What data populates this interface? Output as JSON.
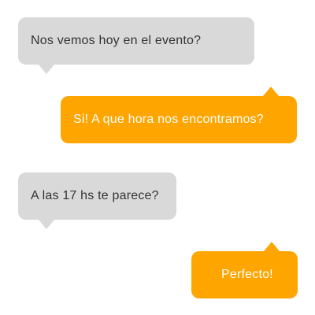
{
  "messages": [
    {
      "sender": "other",
      "text": "Nos vemos hoy en el evento?"
    },
    {
      "sender": "me",
      "text": "Si! A que hora nos encontramos?"
    },
    {
      "sender": "other",
      "text": "A las 17 hs te parece?"
    },
    {
      "sender": "me",
      "text": "Perfecto!"
    }
  ],
  "colors": {
    "incoming_bubble": "#d9d9d9",
    "incoming_text": "#333333",
    "outgoing_bubble": "#ffa500",
    "outgoing_text": "#ffffff"
  }
}
